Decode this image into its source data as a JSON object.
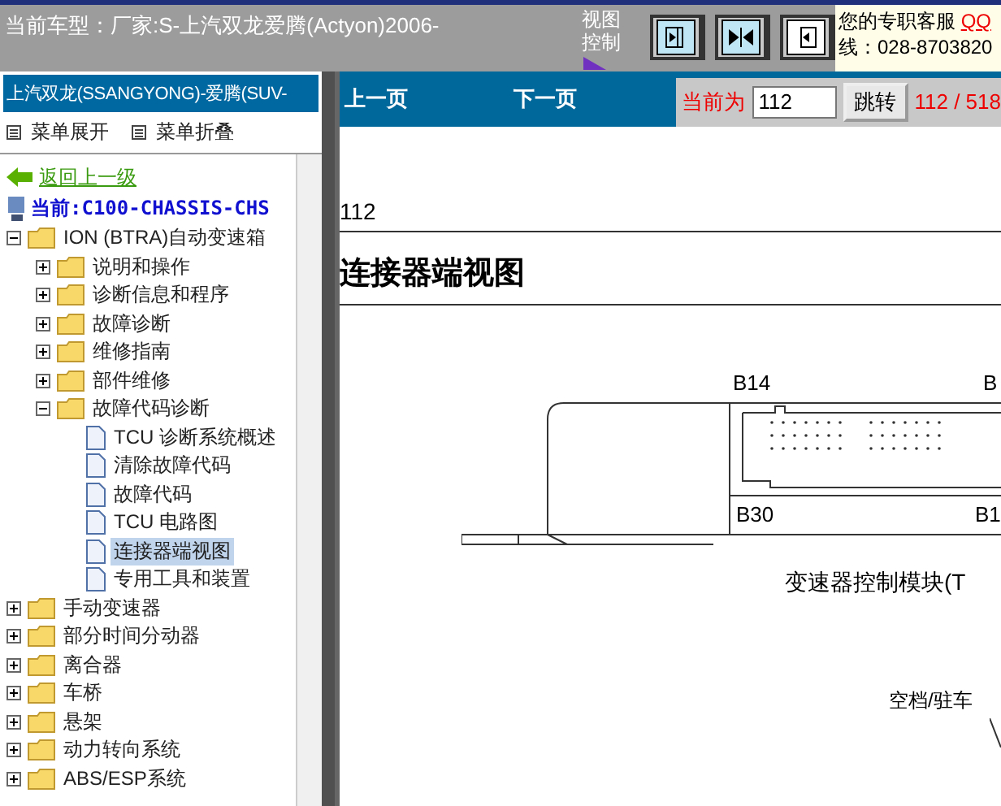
{
  "header": {
    "vehicle": "当前车型：厂家:S-上汽双龙爱腾(Actyon)2006-",
    "view_control": [
      "视图",
      "控制"
    ],
    "service": "您的专职客服",
    "qq": "QQ",
    "phone": "线：028-8703820"
  },
  "sidebar": {
    "title": "上汽双龙(SSANGYONG)-爱腾(SUV-",
    "menu": [
      "菜单展开",
      "菜单折叠"
    ],
    "back": "返回上一级",
    "current": "当前:C100-CHASSIS-CHS",
    "tree": [
      {
        "kind": "folder",
        "label": "ION (BTRA)自动变速箱",
        "expanded": true,
        "selected": false,
        "children": [
          {
            "kind": "folder",
            "label": "说明和操作",
            "expanded": false,
            "selected": false
          },
          {
            "kind": "folder",
            "label": "诊断信息和程序",
            "expanded": false,
            "selected": false
          },
          {
            "kind": "folder",
            "label": "故障诊断",
            "expanded": false,
            "selected": false
          },
          {
            "kind": "folder",
            "label": "维修指南",
            "expanded": false,
            "selected": false
          },
          {
            "kind": "folder",
            "label": "部件维修",
            "expanded": false,
            "selected": false
          },
          {
            "kind": "folder",
            "label": "故障代码诊断",
            "expanded": true,
            "selected": false,
            "children": [
              {
                "kind": "page",
                "label": "TCU 诊断系统概述",
                "selected": false
              },
              {
                "kind": "page",
                "label": "清除故障代码",
                "selected": false
              },
              {
                "kind": "page",
                "label": "故障代码",
                "selected": false
              },
              {
                "kind": "page",
                "label": "TCU 电路图",
                "selected": false
              },
              {
                "kind": "page",
                "label": "连接器端视图",
                "selected": true
              },
              {
                "kind": "page",
                "label": "专用工具和装置",
                "selected": false
              }
            ]
          }
        ]
      },
      {
        "kind": "folder",
        "label": "手动变速器",
        "expanded": false,
        "selected": false
      },
      {
        "kind": "folder",
        "label": "部分时间分动器",
        "expanded": false,
        "selected": false
      },
      {
        "kind": "folder",
        "label": "离合器",
        "expanded": false,
        "selected": false
      },
      {
        "kind": "folder",
        "label": "车桥",
        "expanded": false,
        "selected": false
      },
      {
        "kind": "folder",
        "label": "悬架",
        "expanded": false,
        "selected": false
      },
      {
        "kind": "folder",
        "label": "动力转向系统",
        "expanded": false,
        "selected": false
      },
      {
        "kind": "folder",
        "label": "ABS/ESP系统",
        "expanded": false,
        "selected": false
      }
    ]
  },
  "nav": {
    "prev": "上一页",
    "next": "下一页",
    "current_label": "当前为",
    "page_value": "112",
    "go": "跳转",
    "page_count": "112 / 518"
  },
  "document": {
    "page_number": "112",
    "heading": "连接器端视图",
    "labels": [
      "B14",
      "B",
      "B30",
      "B1"
    ],
    "caption": "变速器控制模块(T",
    "callout": "空档/驻车"
  }
}
